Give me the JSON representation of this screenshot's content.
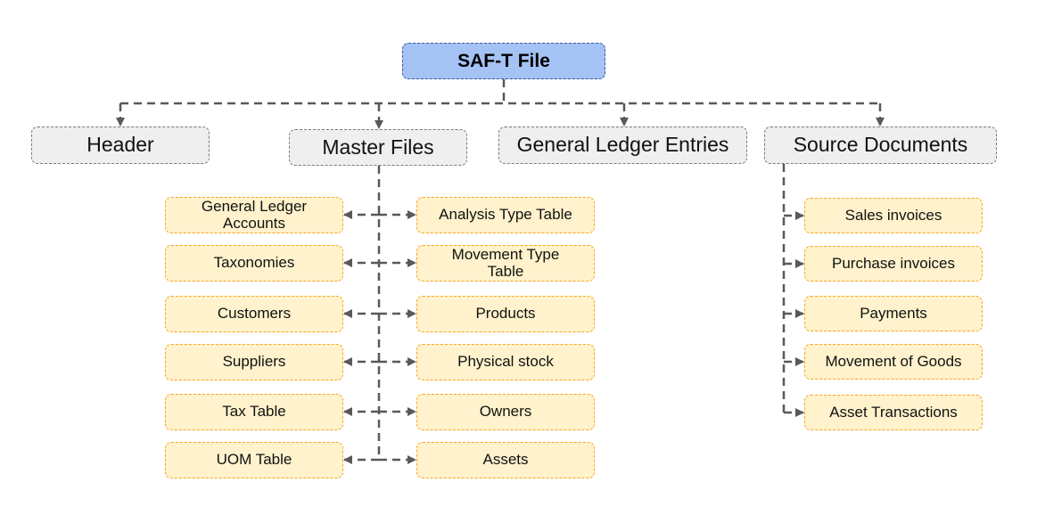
{
  "root": {
    "label": "SAF-T File"
  },
  "sections": [
    {
      "id": "header",
      "label": "Header"
    },
    {
      "id": "master",
      "label": "Master Files"
    },
    {
      "id": "gle",
      "label": "General Ledger Entries"
    },
    {
      "id": "source",
      "label": "Source Documents"
    }
  ],
  "master_files": {
    "left": [
      "General Ledger Accounts",
      "Taxonomies",
      "Customers",
      "Suppliers",
      "Tax Table",
      "UOM Table"
    ],
    "right": [
      "Analysis Type Table",
      "Movement Type Table",
      "Products",
      "Physical stock",
      "Owners",
      "Assets"
    ]
  },
  "source_documents": [
    "Sales invoices",
    "Purchase invoices",
    "Payments",
    "Movement of Goods",
    "Asset Transactions"
  ],
  "colors": {
    "root_fill": "#a4c2f4",
    "section_fill": "#efefef",
    "leaf_fill": "#fff2cc",
    "leaf_border": "#f6a623",
    "connector": "#595959"
  }
}
